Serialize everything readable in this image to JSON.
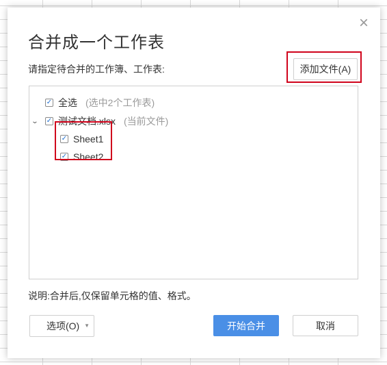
{
  "dialog": {
    "title": "合并成一个工作表",
    "instruction": "请指定待合并的工作簿、工作表:",
    "add_file_label": "添加文件(A)",
    "close_glyph": "×",
    "tree": {
      "select_all": {
        "label": "全选",
        "note": "(选中2个工作表)",
        "checked": true
      },
      "file": {
        "name": "测试文档.xlsx",
        "note": "(当前文件)",
        "checked": true,
        "expanded": true,
        "sheets": [
          {
            "name": "Sheet1",
            "checked": true
          },
          {
            "name": "Sheet2",
            "checked": true
          }
        ]
      }
    },
    "description": "说明:合并后,仅保留单元格的值、格式。",
    "options_label": "选项(O)",
    "start_label": "开始合并",
    "cancel_label": "取消"
  },
  "icons": {
    "check": "✓",
    "expand": "⌄",
    "caret": "▼"
  },
  "colors": {
    "primary": "#4a8fe6",
    "highlight": "#d0021b",
    "check": "#1f6fd1"
  }
}
